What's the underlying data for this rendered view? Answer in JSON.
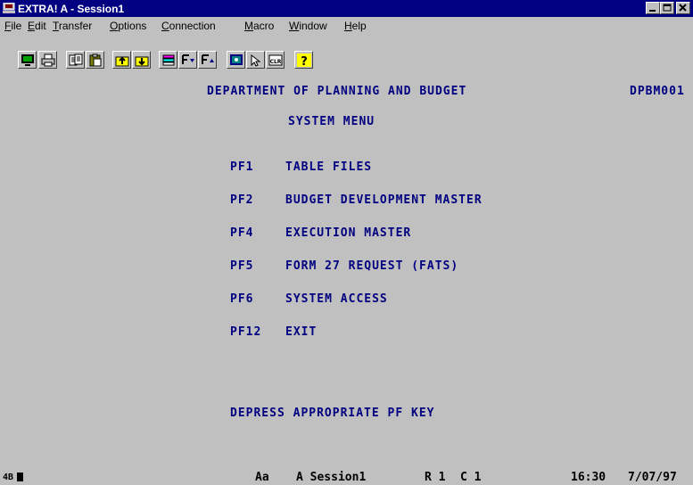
{
  "window": {
    "title": "EXTRA! A - Session1"
  },
  "menu": [
    {
      "pre": "",
      "u": "F",
      "post": "ile"
    },
    {
      "pre": "",
      "u": "E",
      "post": "dit"
    },
    {
      "pre": "",
      "u": "T",
      "post": "ransfer"
    },
    {
      "pre": "",
      "u": "O",
      "post": "ptions"
    },
    {
      "pre": "",
      "u": "C",
      "post": "onnection"
    },
    {
      "pre": "",
      "u": "M",
      "post": "acro"
    },
    {
      "pre": "",
      "u": "W",
      "post": "indow"
    },
    {
      "pre": "",
      "u": "H",
      "post": "elp"
    }
  ],
  "toolbar": {
    "icons": [
      "display-icon",
      "print-icon",
      "copy-icon",
      "paste-icon",
      "upload-icon",
      "download-icon",
      "send-icon",
      "font-down-icon",
      "font-up-icon",
      "session-info-icon",
      "pointer-icon",
      "clear-icon",
      "help-icon"
    ],
    "clear_label": "CLR",
    "help_label": "?"
  },
  "screen": {
    "header": "DEPARTMENT OF PLANNING AND BUDGET",
    "screen_id": "DPBM001",
    "menu_title": "SYSTEM MENU",
    "options": [
      {
        "key": "PF1",
        "label": "TABLE FILES"
      },
      {
        "key": "PF2",
        "label": "BUDGET DEVELOPMENT MASTER"
      },
      {
        "key": "PF4",
        "label": "EXECUTION MASTER"
      },
      {
        "key": "PF5",
        "label": "FORM 27 REQUEST (FATS)"
      },
      {
        "key": "PF6",
        "label": "SYSTEM ACCESS"
      },
      {
        "key": "PF12",
        "label": "EXIT"
      }
    ],
    "instruction": "DEPRESS APPROPRIATE PF KEY"
  },
  "status": {
    "indicator": "4B",
    "font": "Aa",
    "session": "A Session1",
    "row": "R 1",
    "col": "C 1",
    "time": "16:30",
    "date": "7/07/97"
  }
}
